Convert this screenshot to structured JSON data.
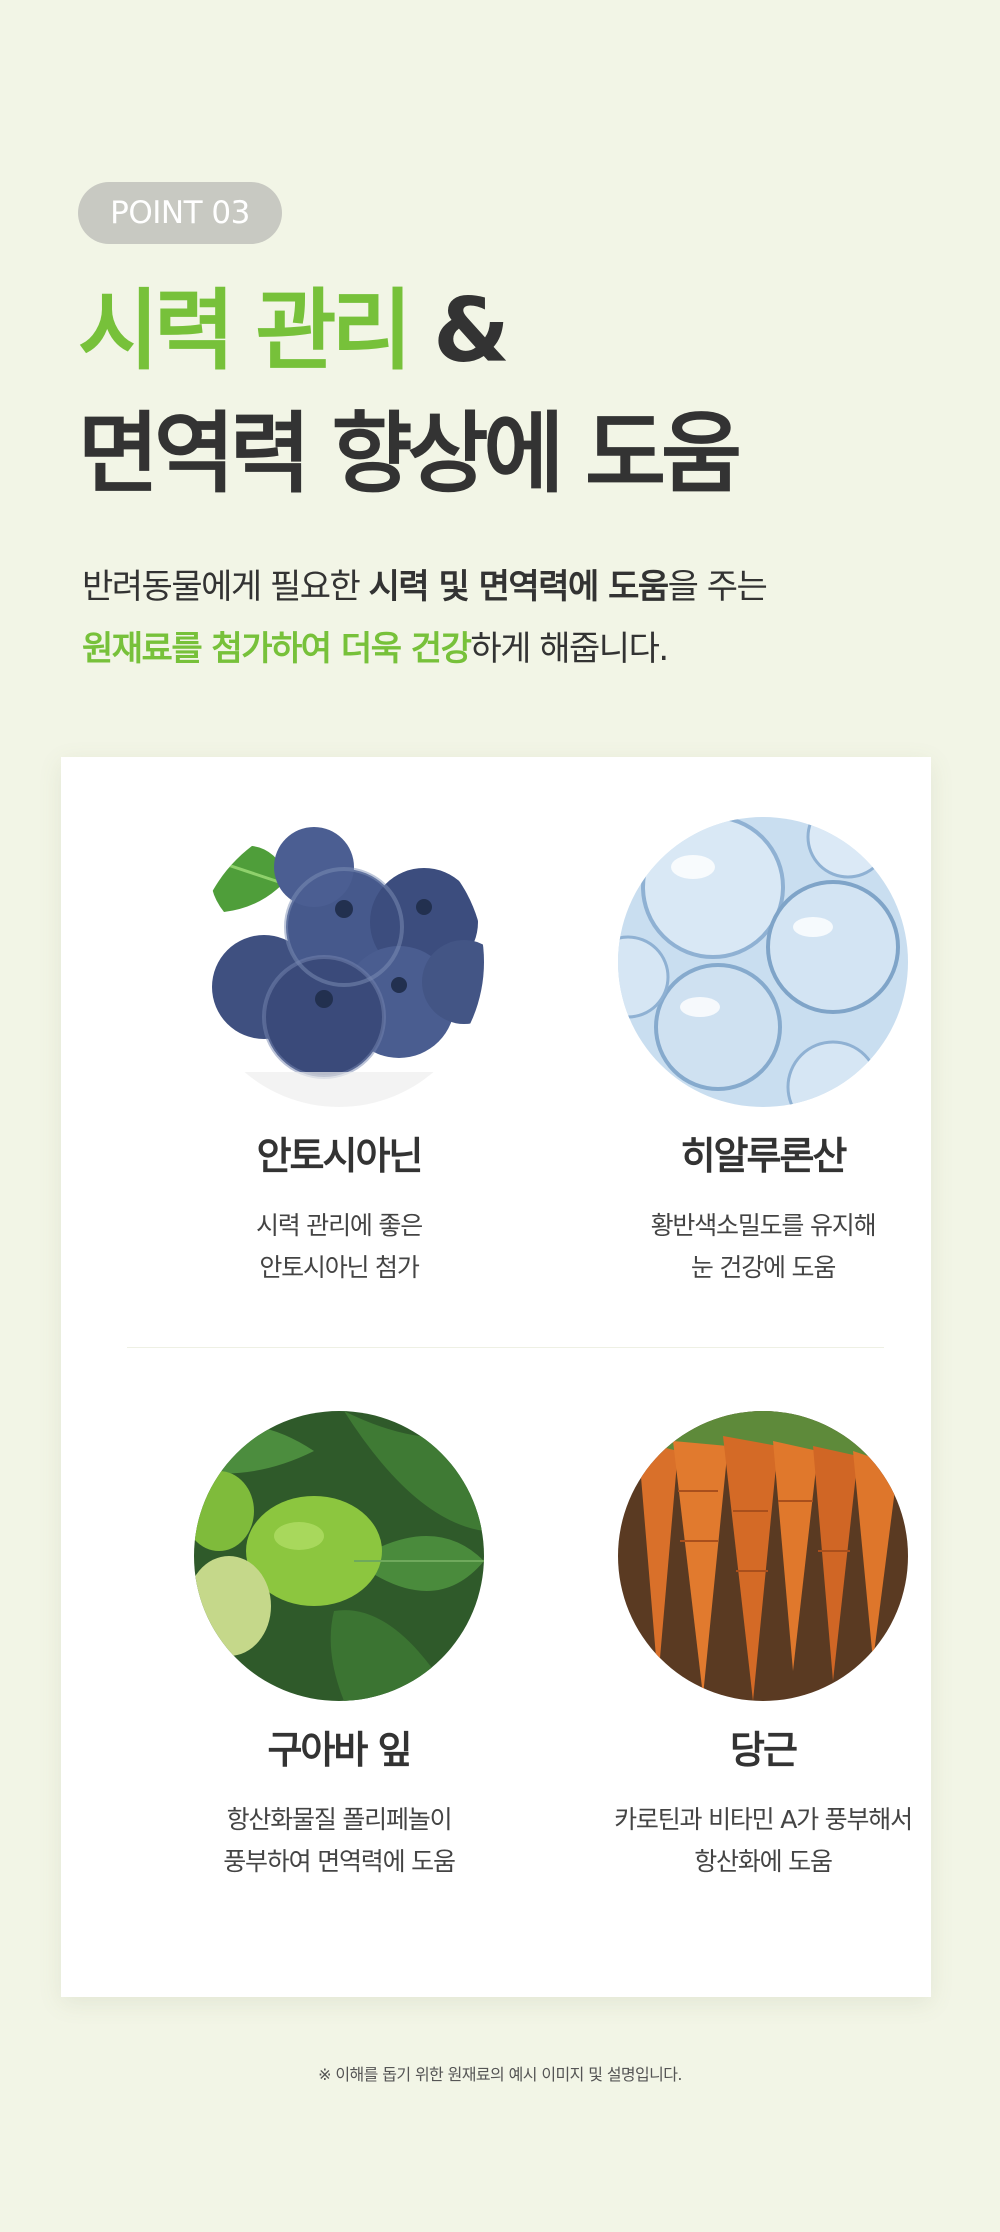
{
  "badge": "POINT 03",
  "headline": {
    "line1_highlight": "시력 관리",
    "line1_rest": " &",
    "line2": "면역력 향상에 도움"
  },
  "intro": {
    "line1_a": "반려동물에게 필요한 ",
    "line1_b": "시력 및 면역력에 도움",
    "line1_c": "을 주는",
    "line2_a": "원재료를 첨가하여 더욱 건강",
    "line2_b": "하게 해줍니다."
  },
  "ingredients": [
    {
      "icon": "blueberry-photo",
      "name": "안토시아닌",
      "desc": [
        "시력 관리에 좋은",
        "안토시아닌 첨가"
      ]
    },
    {
      "icon": "hyaluronic-bubbles-photo",
      "name": "히알루론산",
      "desc": [
        "황반색소밀도를 유지해",
        "눈 건강에 도움"
      ]
    },
    {
      "icon": "guava-leaf-photo",
      "name": "구아바 잎",
      "desc": [
        "항산화물질 폴리페놀이",
        "풍부하여 면역력에 도움"
      ]
    },
    {
      "icon": "carrot-photo",
      "name": "당근",
      "desc": [
        "카로틴과 비타민 A가 풍부해서",
        "항산화에 도움"
      ]
    }
  ],
  "footnote": "※ 이해를 돕기 위한 원재료의 예시 이미지 및 설명입니다.",
  "colors": {
    "background": "#f2f5e6",
    "accent_green": "#77c13a",
    "text_dark": "#333333",
    "badge": "#c8c9c2"
  }
}
